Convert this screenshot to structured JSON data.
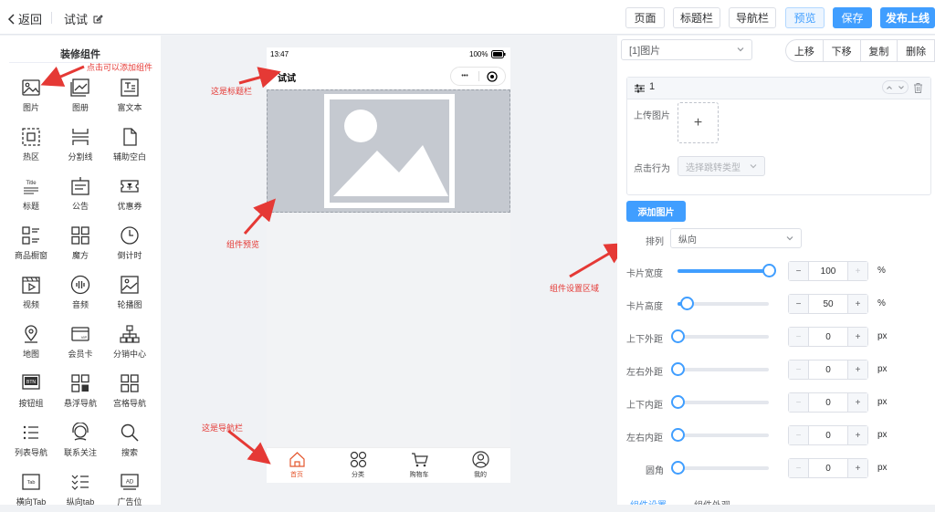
{
  "header": {
    "back_label": "返回",
    "page_title": "试试",
    "buttons": {
      "page": "页面",
      "titlebar": "标题栏",
      "navbar": "导航栏",
      "preview": "预览",
      "save": "保存",
      "publish": "发布上线"
    }
  },
  "sidebar": {
    "title": "装修组件",
    "items": [
      {
        "label": "图片",
        "icon": "image-icon"
      },
      {
        "label": "图册",
        "icon": "album-icon"
      },
      {
        "label": "富文本",
        "icon": "rich-text-icon"
      },
      {
        "label": "热区",
        "icon": "hotspot-icon"
      },
      {
        "label": "分割线",
        "icon": "divider-icon"
      },
      {
        "label": "辅助空白",
        "icon": "blank-icon"
      },
      {
        "label": "标题",
        "icon": "title-icon"
      },
      {
        "label": "公告",
        "icon": "notice-icon"
      },
      {
        "label": "优惠券",
        "icon": "coupon-icon"
      },
      {
        "label": "商品橱窗",
        "icon": "goods-window-icon"
      },
      {
        "label": "魔方",
        "icon": "cube-icon"
      },
      {
        "label": "倒计时",
        "icon": "countdown-icon"
      },
      {
        "label": "视频",
        "icon": "video-icon"
      },
      {
        "label": "音频",
        "icon": "audio-icon"
      },
      {
        "label": "轮播图",
        "icon": "carousel-icon"
      },
      {
        "label": "地图",
        "icon": "map-icon"
      },
      {
        "label": "会员卡",
        "icon": "member-card-icon"
      },
      {
        "label": "分销中心",
        "icon": "distribution-icon"
      },
      {
        "label": "按钮组",
        "icon": "button-group-icon"
      },
      {
        "label": "悬浮导航",
        "icon": "float-nav-icon"
      },
      {
        "label": "宫格导航",
        "icon": "grid-nav-icon"
      },
      {
        "label": "列表导航",
        "icon": "list-nav-icon"
      },
      {
        "label": "联系关注",
        "icon": "contact-icon"
      },
      {
        "label": "搜索",
        "icon": "search-icon"
      },
      {
        "label": "横向Tab",
        "icon": "horizontal-tab-icon"
      },
      {
        "label": "纵向tab",
        "icon": "vertical-tab-icon"
      },
      {
        "label": "广告位",
        "icon": "ad-icon"
      }
    ],
    "icon_texts": {
      "title": "Title",
      "button_group": "BTN",
      "tab": "Tab",
      "ad": "AD",
      "member_card": "VIP"
    }
  },
  "annotations": {
    "add_component": "点击可以添加组件",
    "titlebar": "这是标题栏",
    "preview": "组件预览",
    "settings": "组件设置区域",
    "navbar": "这是导航栏",
    "color": "#e53935"
  },
  "phone": {
    "time": "13:47",
    "battery": "100%",
    "title": "试试",
    "more_glyph": "•••",
    "tabs": [
      {
        "label": "首页",
        "icon": "home-icon",
        "active": true
      },
      {
        "label": "分类",
        "icon": "category-icon",
        "active": false
      },
      {
        "label": "购物车",
        "icon": "cart-icon",
        "active": false
      },
      {
        "label": "我的",
        "icon": "user-icon",
        "active": false
      }
    ],
    "active_color": "#e4572e"
  },
  "settings": {
    "component_select": "[1]图片",
    "actions": {
      "up": "上移",
      "down": "下移",
      "copy": "复制",
      "delete": "删除"
    },
    "item_index": "1",
    "upload_label": "上传图片",
    "upload_plus": "+",
    "click_action_label": "点击行为",
    "click_action_placeholder": "选择跳转类型",
    "add_image": "添加图片",
    "arrange_label": "排列",
    "arrange_value": "纵向",
    "sliders": [
      {
        "label": "卡片宽度",
        "value": "100",
        "unit": "%",
        "fraction": 1.0
      },
      {
        "label": "卡片高度",
        "value": "50",
        "unit": "%",
        "fraction": 0.1
      },
      {
        "label": "上下外距",
        "value": "0",
        "unit": "px",
        "fraction": 0
      },
      {
        "label": "左右外距",
        "value": "0",
        "unit": "px",
        "fraction": 0
      },
      {
        "label": "上下内距",
        "value": "0",
        "unit": "px",
        "fraction": 0
      },
      {
        "label": "左右内距",
        "value": "0",
        "unit": "px",
        "fraction": 0
      },
      {
        "label": "圆角",
        "value": "0",
        "unit": "px",
        "fraction": 0
      }
    ],
    "stepper_minus": "−",
    "stepper_plus": "+",
    "bottom_tabs": [
      "组件设置",
      "组件外观"
    ]
  },
  "colors": {
    "primary": "#409eff",
    "annotation": "#e53935"
  }
}
